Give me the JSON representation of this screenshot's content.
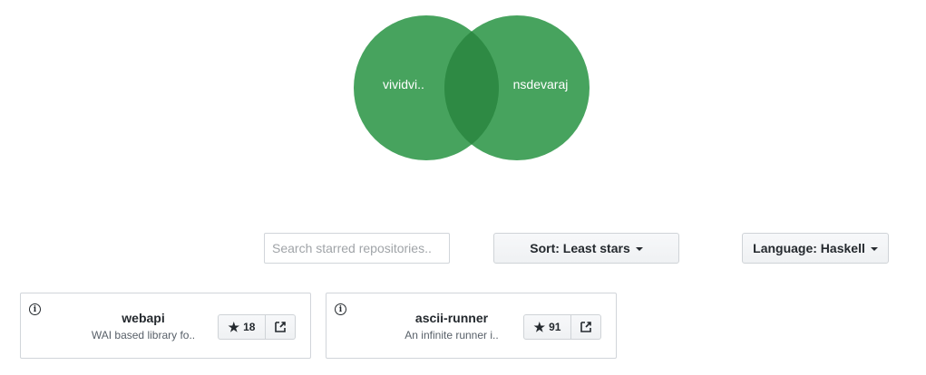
{
  "venn": {
    "left_label": "vividvi..",
    "right_label": "nsdevaraj",
    "circle_color": "#33994c",
    "overlap_color": "#2e8a44"
  },
  "search": {
    "placeholder": "Search starred repositories.."
  },
  "sort": {
    "label": "Sort: Least stars"
  },
  "language": {
    "label": "Language: Haskell"
  },
  "repos": [
    {
      "name": "webapi",
      "description": "WAI based library fo..",
      "stars": "18"
    },
    {
      "name": "ascii-runner",
      "description": "An infinite runner i..",
      "stars": "91"
    }
  ],
  "icons": {
    "info": "info-icon",
    "star": "star-icon",
    "external": "external-link-icon",
    "caret": "caret-down-icon"
  }
}
